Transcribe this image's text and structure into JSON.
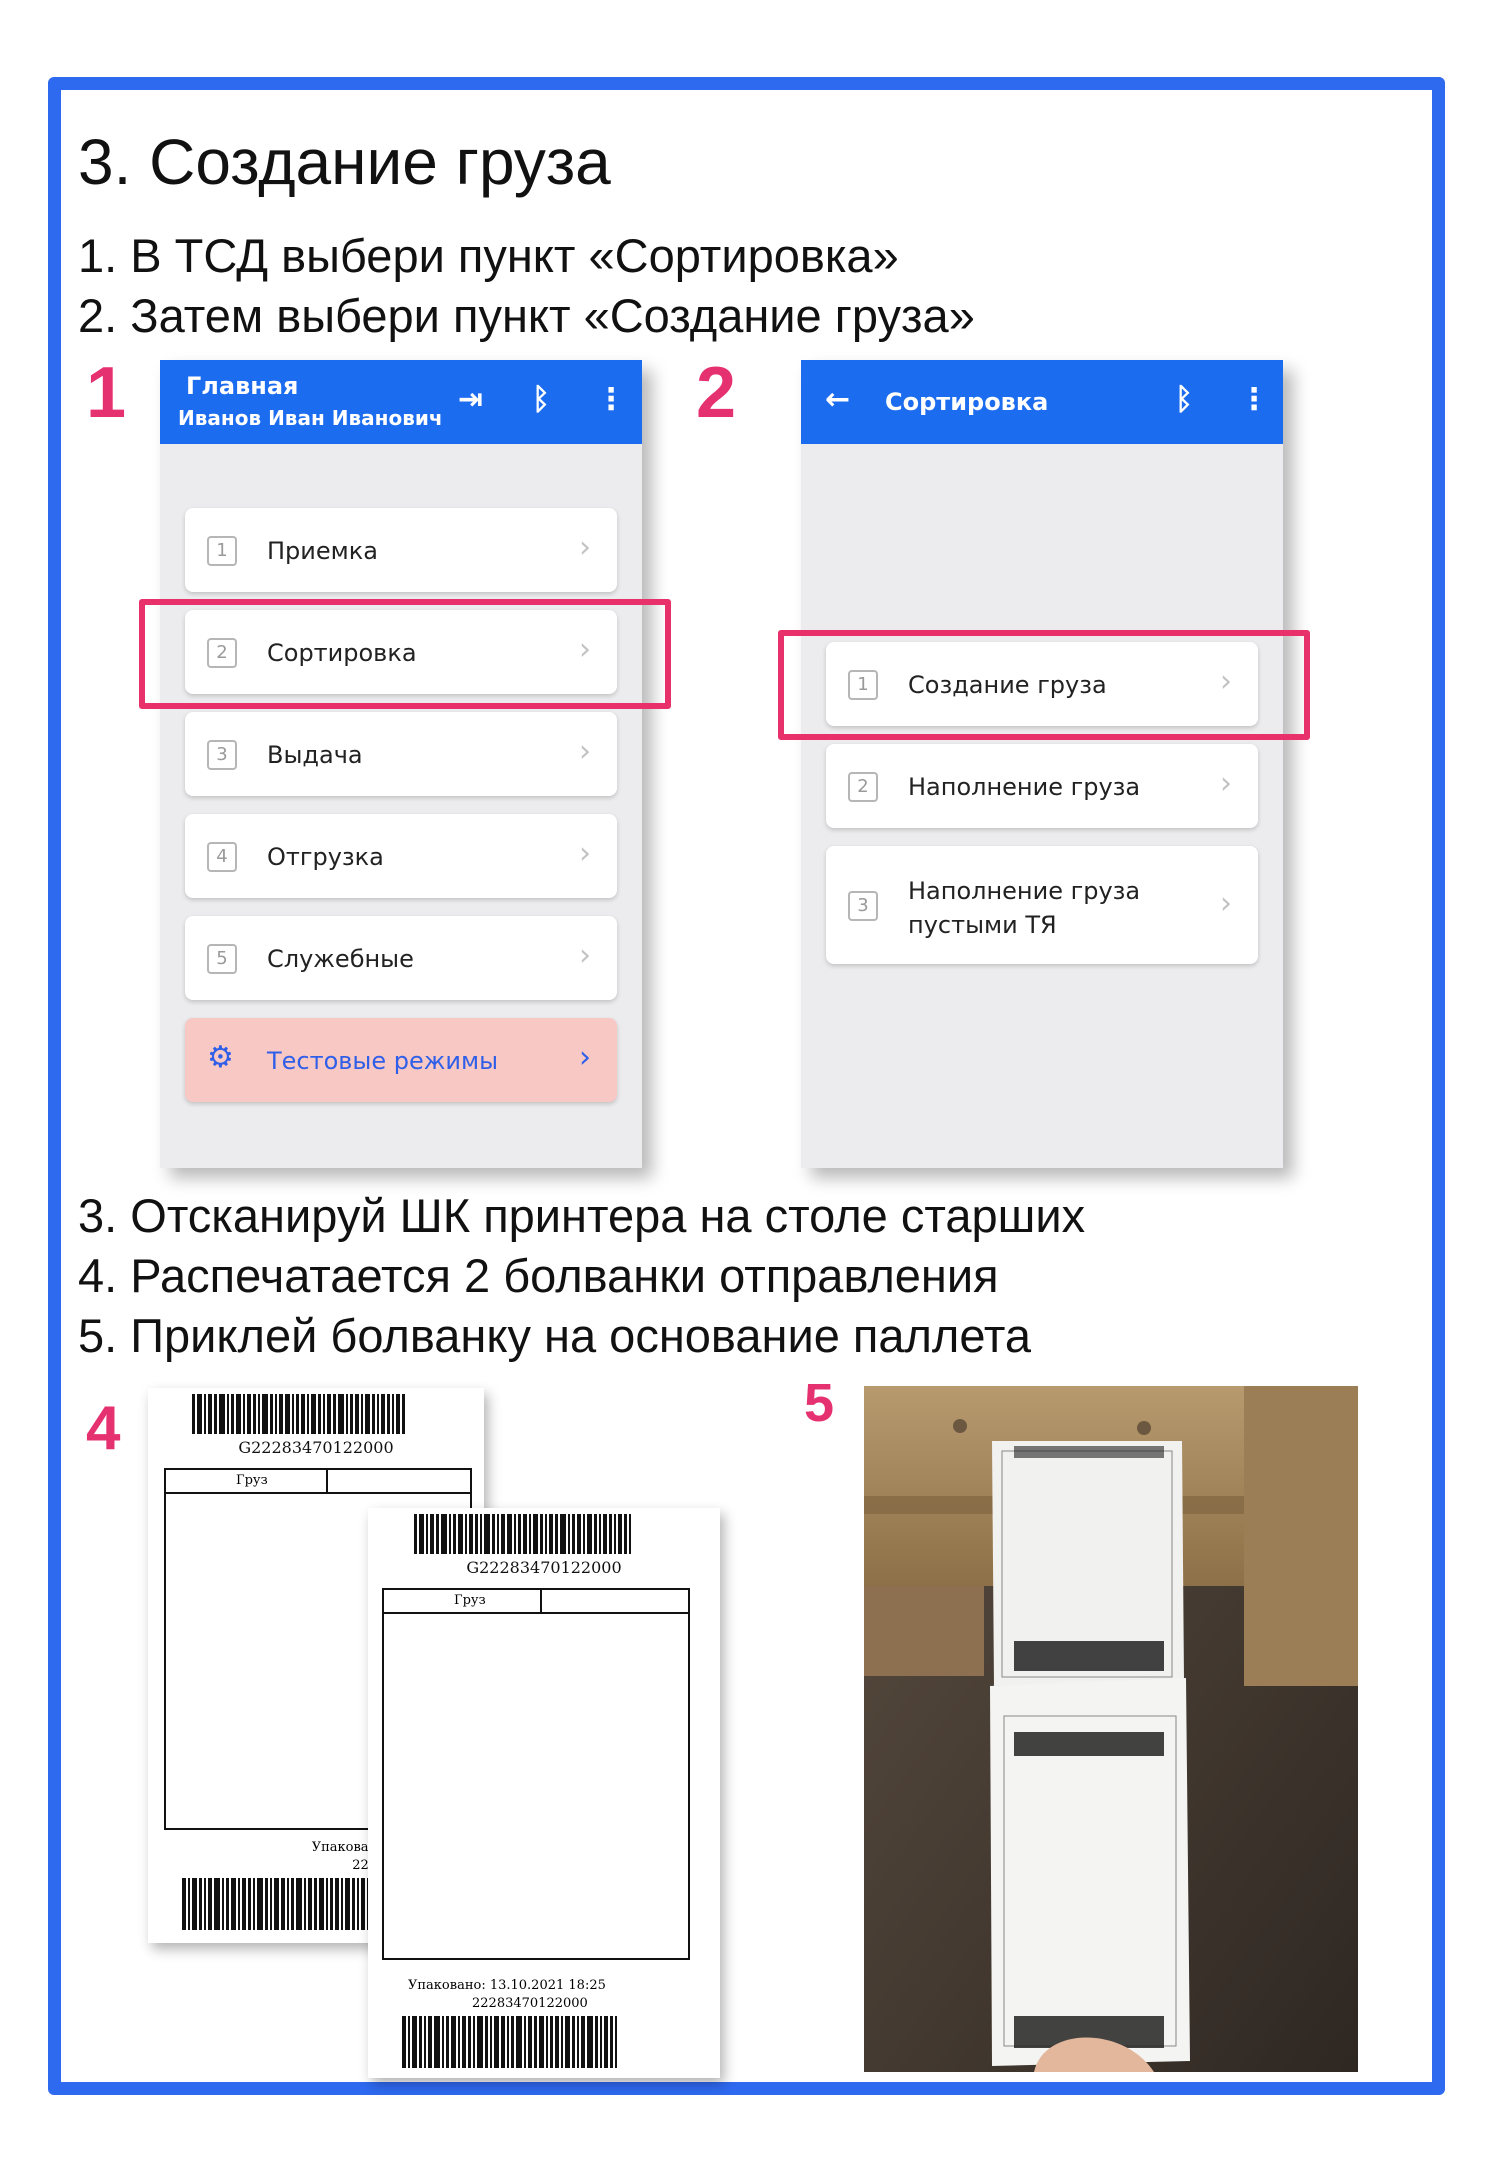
{
  "title": "3. Создание груза",
  "steps": {
    "s1": "1. В ТСД выбери пункт «Сортировка»",
    "s2": "2. Затем выбери пункт «Создание груза»",
    "s3": "3. Отсканируй ШК принтера на столе старших",
    "s4": "4. Распечатается 2 болванки отправления",
    "s5": "5. Приклей болванку на основание паллета"
  },
  "markers": {
    "m1": "1",
    "m2": "2",
    "m4": "4",
    "m5": "5"
  },
  "screen1": {
    "title": "Главная",
    "user": "Иванов Иван Иванович",
    "icons": [
      "logout-icon",
      "bluetooth-icon",
      "more-icon"
    ],
    "items": [
      {
        "index": "1",
        "label": "Приемка"
      },
      {
        "index": "2",
        "label": "Сортировка"
      },
      {
        "index": "3",
        "label": "Выдача"
      },
      {
        "index": "4",
        "label": "Отгрузка"
      },
      {
        "index": "5",
        "label": "Служебные"
      }
    ],
    "test_modes": "Тестовые режимы"
  },
  "screen2": {
    "title": "Сортировка",
    "icons": [
      "back-arrow-icon",
      "bluetooth-icon",
      "more-icon"
    ],
    "items": [
      {
        "index": "1",
        "label": "Создание груза"
      },
      {
        "index": "2",
        "label": "Наполнение груза"
      },
      {
        "index": "3",
        "label": "Наполнение груза пустыми ТЯ"
      }
    ]
  },
  "labels": {
    "code": "G22283470122000",
    "cargo": "Груз",
    "packed_back": "Упаковано: 13.10.2021",
    "packed_front": "Упаковано: 13.10.2021 18:25",
    "number": "22283470122000"
  },
  "colors": {
    "frame": "#2e6af0",
    "accent_pink": "#e63170",
    "appbar": "#1c6cf0",
    "test_modes_bg": "#f8c8c4"
  }
}
